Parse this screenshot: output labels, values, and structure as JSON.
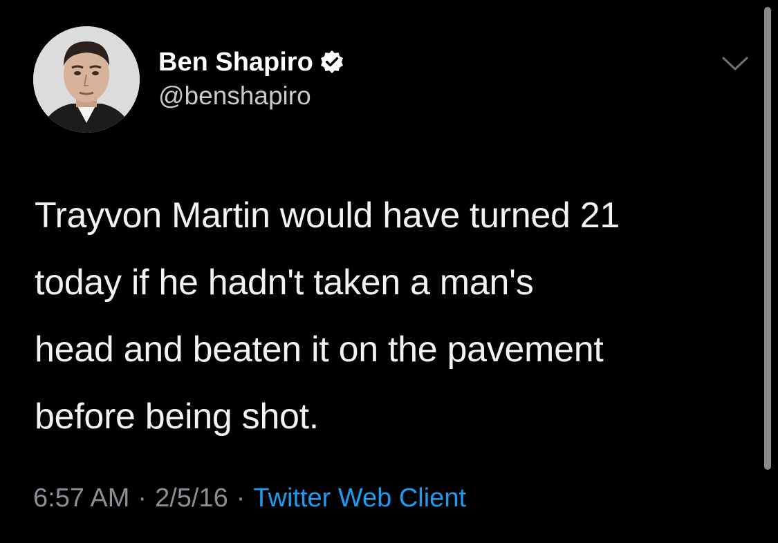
{
  "tweet": {
    "author": {
      "display_name": "Ben Shapiro",
      "handle": "@benshapiro",
      "verified": true,
      "verified_icon": "verified-badge-icon",
      "avatar_icon": "profile-photo"
    },
    "text_lines": [
      "Trayvon Martin would have turned 21",
      "today if he hadn't taken a man's",
      "head and beaten it on the pavement",
      "before being shot."
    ],
    "time": "6:57 AM",
    "separator": "·",
    "date": "2/5/16",
    "source": "Twitter Web Client",
    "more_menu_icon": "chevron-down-icon"
  },
  "colors": {
    "background": "#000000",
    "text": "#f2f2f2",
    "muted": "#8b9096",
    "link": "#1d9bf0"
  }
}
